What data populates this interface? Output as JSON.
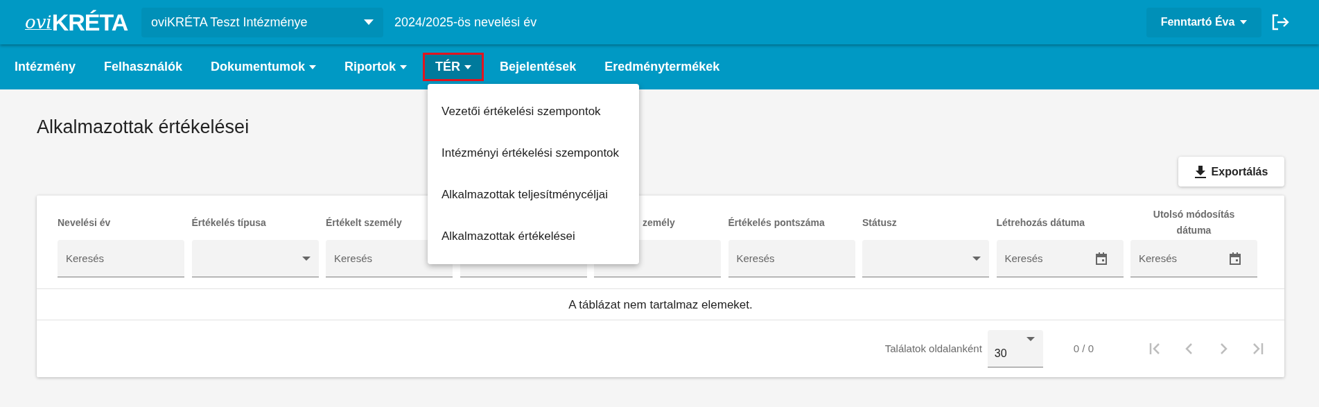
{
  "header": {
    "logo": {
      "script": "ovi",
      "name": "KRÉTA"
    },
    "institution": {
      "value": "oviKRÉTA Teszt Intézménye"
    },
    "school_year": "2024/2025-ös nevelési év",
    "user_menu": {
      "label": "Fenntartó Éva"
    }
  },
  "nav": [
    {
      "label": "Intézmény",
      "dropdown": false,
      "selected": false
    },
    {
      "label": "Felhasználók",
      "dropdown": false,
      "selected": false
    },
    {
      "label": "Dokumentumok",
      "dropdown": true,
      "selected": false
    },
    {
      "label": "Riportok",
      "dropdown": true,
      "selected": false
    },
    {
      "label": "TÉR",
      "dropdown": true,
      "selected": true
    },
    {
      "label": "Bejelentések",
      "dropdown": false,
      "selected": false
    },
    {
      "label": "Eredménytermékek",
      "dropdown": false,
      "selected": false
    }
  ],
  "open_menu": {
    "items": [
      "Vezetői értékelési szempontok",
      "Intézményi értékelési szempontok",
      "Alkalmazottak teljesítménycéljai",
      "Alkalmazottak értékelései"
    ]
  },
  "page_title": "Alkalmazottak értékelései",
  "export_button": {
    "label": "Exportálás"
  },
  "table": {
    "columns": [
      {
        "label": "Nevelési év",
        "filter": {
          "kind": "text",
          "placeholder": "Keresés"
        }
      },
      {
        "label": "Értékelés típusa",
        "filter": {
          "kind": "select"
        }
      },
      {
        "label": "Értékelt személy",
        "filter": {
          "kind": "text",
          "placeholder": "Keresés"
        }
      },
      {
        "filter": {
          "kind": "text"
        }
      },
      {
        "label": "zemély",
        "partly_hidden": true,
        "filter": {
          "kind": "text"
        }
      },
      {
        "label": "Értékelés pontszáma",
        "filter": {
          "kind": "text",
          "placeholder": "Keresés"
        }
      },
      {
        "label": "Státusz",
        "filter": {
          "kind": "select"
        }
      },
      {
        "label": "Létrehozás dátuma",
        "filter": {
          "kind": "date",
          "placeholder": "Keresés"
        }
      },
      {
        "label": "Utolsó módosítás dátuma",
        "filter": {
          "kind": "date",
          "placeholder": "Keresés"
        }
      }
    ],
    "empty_message": "A táblázat nem tartalmaz elemeket."
  },
  "footer": {
    "page_size_label": "Találatok oldalanként",
    "page_size": "30",
    "page_info": "0 / 0",
    "pager": [
      {
        "kind": "first",
        "disabled": true
      },
      {
        "kind": "prev",
        "disabled": true
      },
      {
        "kind": "next",
        "disabled": true
      },
      {
        "kind": "last",
        "disabled": true
      }
    ]
  }
}
